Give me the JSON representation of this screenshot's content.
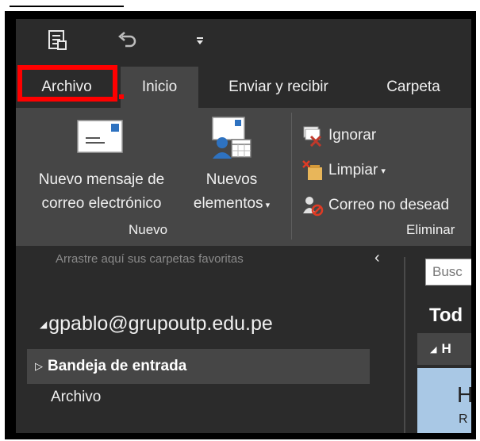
{
  "ribbon_tabs": [
    {
      "label": "Archivo",
      "highlighted": true
    },
    {
      "label": "Inicio",
      "active": true
    },
    {
      "label": "Enviar y recibir"
    },
    {
      "label": "Carpeta"
    }
  ],
  "quick_access": {
    "icons": [
      "send-receive-all-icon",
      "undo-icon",
      "customize-toolbar-icon"
    ]
  },
  "ribbon": {
    "new_email": {
      "line1": "Nuevo mensaje de",
      "line2": "correo electrónico",
      "icon": "envelope-icon"
    },
    "new_items": {
      "line1": "Nuevos",
      "line2": "elementos",
      "icon": "new-items-icon"
    },
    "group_new": "Nuevo",
    "ignore": "Ignorar",
    "clean": "Limpiar",
    "junk": "Correo no desead",
    "group_delete": "Eliminar"
  },
  "folder_pane": {
    "favorites_hint": "Arrastre aquí sus carpetas favoritas",
    "account": "gpablo@grupoutp.edu.pe",
    "inbox": "Bandeja de entrada",
    "archive": "Archivo"
  },
  "message_list": {
    "search_placeholder": "Busc",
    "filter_all": "Tod",
    "group_today": "H",
    "first_message_initial": "H",
    "first_message_sub": "R"
  },
  "colors": {
    "background": "#2b2b2b",
    "ribbon": "#464646",
    "highlight": "#ff0000",
    "selected_message": "#a9c8e5"
  }
}
